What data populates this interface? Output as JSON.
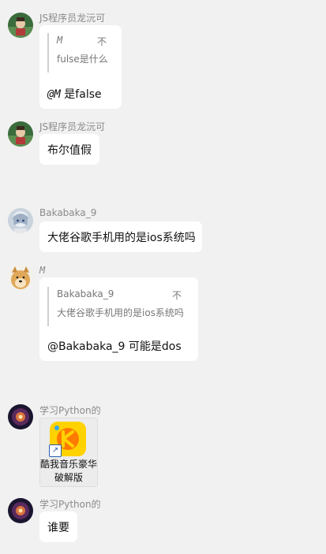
{
  "messages": [
    {
      "sender": "JS程序员龙沅可",
      "quote": {
        "name": "M",
        "flag": "不",
        "text": "fulse是什么"
      },
      "text": "@M 是false",
      "mention": "@M"
    },
    {
      "sender": "JS程序员龙沅可",
      "text": "布尔值假"
    },
    {
      "sender": "Bakabaka_9",
      "text": "大佬谷歌手机用的是ios系统吗"
    },
    {
      "sender": "M",
      "quote": {
        "name": "Bakabaka_9",
        "flag": "不",
        "text": "大佬谷歌手机用的是ios系统吗"
      },
      "text": "@Bakabaka_9 可能是dos"
    },
    {
      "sender": "学习Python的",
      "file_label": "酷我音乐豪华破解版"
    },
    {
      "sender": "学习Python的",
      "text": "谁要"
    }
  ],
  "colors": {
    "background": "#f1f1f1",
    "bubble": "#ffffff",
    "sender_text": "#8a8a8a",
    "app_icon": "#ffd200"
  },
  "icons": {
    "avatar_js": "anime-character-avatar",
    "avatar_baka": "anime-girl-avatar",
    "avatar_m": "doge-avatar",
    "avatar_py": "galaxy-avatar",
    "app": "kuwo-music-app-icon",
    "shortcut": "shortcut-arrow-icon"
  }
}
